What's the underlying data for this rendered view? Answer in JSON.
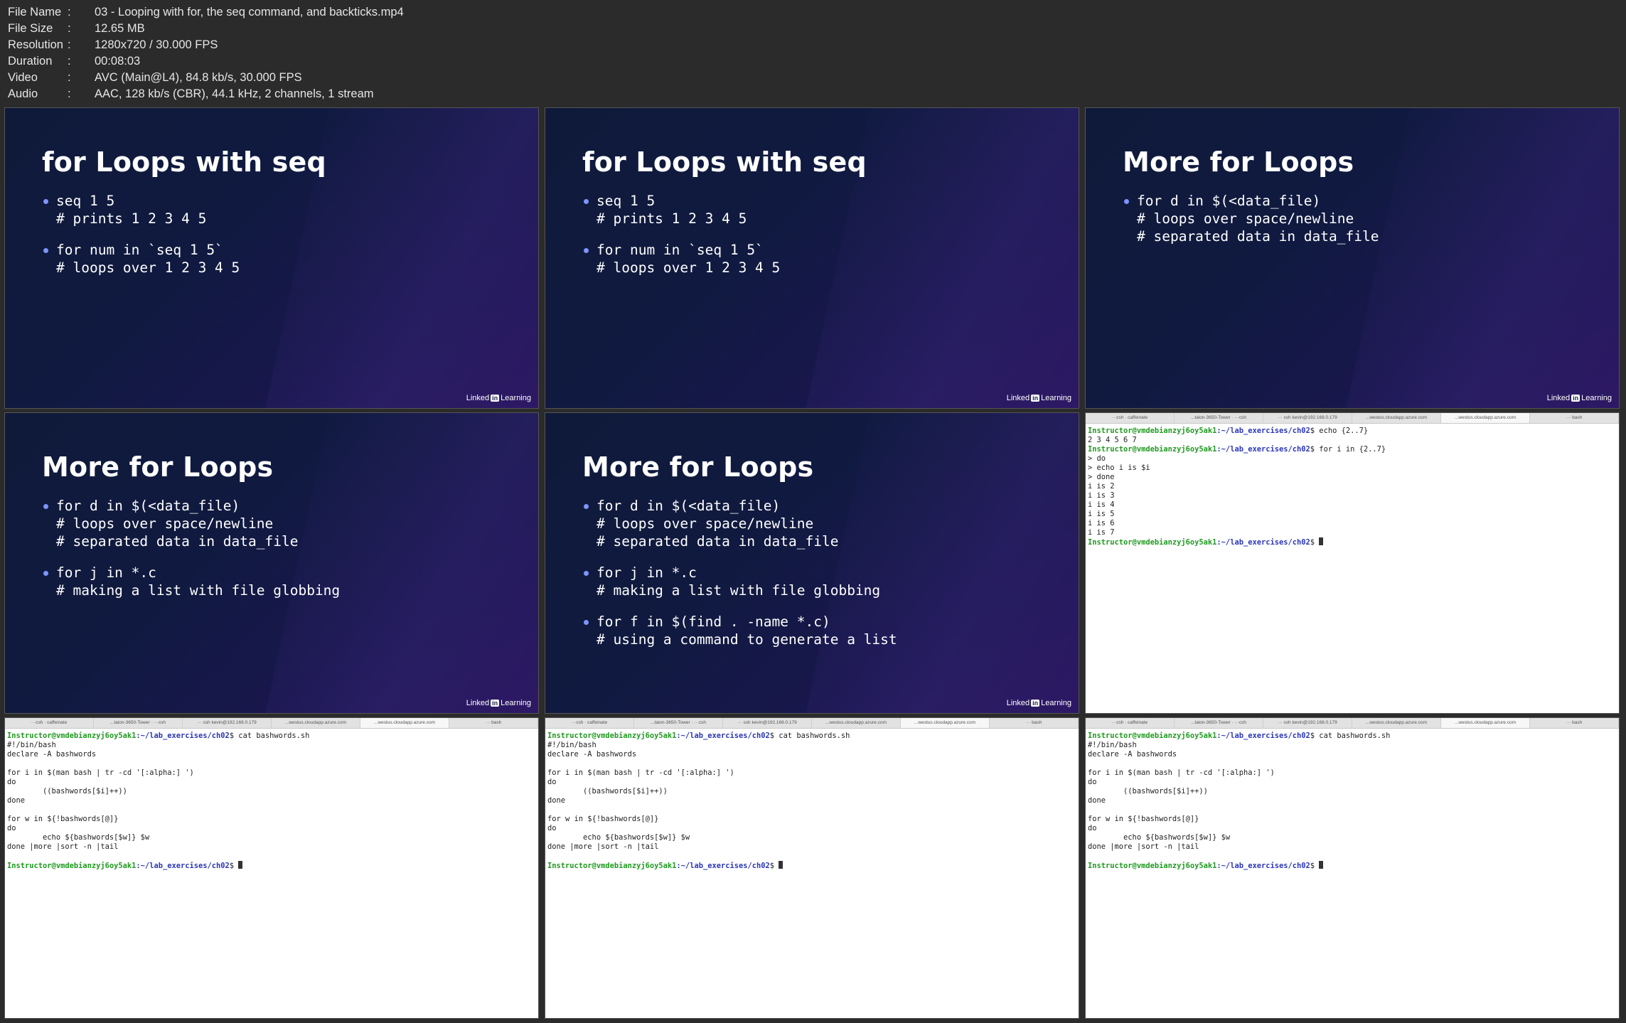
{
  "file_info": [
    {
      "key": "File Name",
      "value": "03 - Looping with for, the seq command, and backticks.mp4"
    },
    {
      "key": "File Size",
      "value": "12.65 MB"
    },
    {
      "key": "Resolution",
      "value": "1280x720 / 30.000 FPS"
    },
    {
      "key": "Duration",
      "value": "00:08:03"
    },
    {
      "key": "Video",
      "value": "AVC (Main@L4), 84.8 kb/s, 30.000 FPS"
    },
    {
      "key": "Audio",
      "value": "AAC, 128 kb/s (CBR), 44.1 kHz, 2 channels, 1 stream"
    }
  ],
  "separator": ":",
  "slide_logo": {
    "left": "Linked",
    "in": "in",
    "right": "Learning"
  },
  "terminal_tabs": [
    "···csh · caffeinate",
    "...taion-3650-Tower · ···csh",
    "··· ssh kevin@192.168.0.179",
    "...westus.cloudapp.azure.com",
    "...westus.cloudapp.azure.com",
    "··· bash"
  ],
  "frames": [
    {
      "title": "for Loops with seq",
      "bullets": [
        [
          "seq 1 5",
          "# prints 1 2 3 4 5"
        ],
        [
          "for num in `seq 1 5`",
          "# loops over 1 2 3 4 5"
        ]
      ]
    },
    {
      "title": "for Loops with seq",
      "bullets": [
        [
          "seq 1 5",
          "# prints 1 2 3 4 5"
        ],
        [
          "for num in `seq 1 5`",
          "# loops over 1 2 3 4 5"
        ]
      ]
    },
    {
      "title": "More for Loops",
      "bullets": [
        [
          "for d in $(<data_file)",
          "# loops over space/newline",
          "# separated data in data_file"
        ]
      ]
    },
    {
      "title": "More for Loops",
      "bullets": [
        [
          "for d in $(<data_file)",
          "# loops over space/newline",
          "# separated data in data_file"
        ],
        [
          "for j in *.c",
          "# making a list with file globbing"
        ]
      ]
    },
    {
      "title": "More for Loops",
      "bullets": [
        [
          "for d in $(<data_file)",
          "# loops over space/newline",
          "# separated data in data_file"
        ],
        [
          "for j in *.c",
          "# making a list with file globbing"
        ],
        [
          "for f in $(find . -name *.c)",
          "# using a command to generate a list"
        ]
      ]
    },
    {
      "active_tab": 4,
      "lines": [
        {
          "prompt": true,
          "user": "Instructor@vmdebianzyj6oy5ak1",
          "path": ":~/lab_exercises/ch02",
          "cmd": "$ echo {2..7}"
        },
        {
          "text": "2 3 4 5 6 7"
        },
        {
          "prompt": true,
          "user": "Instructor@vmdebianzyj6oy5ak1",
          "path": ":~/lab_exercises/ch02",
          "cmd": "$ for i in {2..7}"
        },
        {
          "text": "> do"
        },
        {
          "text": "> echo i is $i"
        },
        {
          "text": "> done"
        },
        {
          "text": "i is 2"
        },
        {
          "text": "i is 3"
        },
        {
          "text": "i is 4"
        },
        {
          "text": "i is 5"
        },
        {
          "text": "i is 6"
        },
        {
          "text": "i is 7"
        },
        {
          "prompt": true,
          "user": "Instructor@vmdebianzyj6oy5ak1",
          "path": ":~/lab_exercises/ch02",
          "cmd": "$ ",
          "cursor": true
        }
      ]
    },
    {
      "active_tab": 4,
      "lines": [
        {
          "prompt": true,
          "user": "Instructor@vmdebianzyj6oy5ak1",
          "path": ":~/lab_exercises/ch02",
          "cmd": "$ cat bashwords.sh"
        },
        {
          "text": "#!/bin/bash"
        },
        {
          "text": "declare -A bashwords"
        },
        {
          "text": ""
        },
        {
          "text": "for i in $(man bash | tr -cd '[:alpha:] ')"
        },
        {
          "text": "do"
        },
        {
          "text": "        ((bashwords[$i]++))"
        },
        {
          "text": "done"
        },
        {
          "text": ""
        },
        {
          "text": "for w in ${!bashwords[@]}"
        },
        {
          "text": "do"
        },
        {
          "text": "        echo ${bashwords[$w]} $w"
        },
        {
          "text": "done |more |sort -n |tail"
        },
        {
          "text": ""
        },
        {
          "prompt": true,
          "user": "Instructor@vmdebianzyj6oy5ak1",
          "path": ":~/lab_exercises/ch02",
          "cmd": "$ ",
          "cursor": true
        }
      ]
    },
    {
      "active_tab": 4,
      "lines": [
        {
          "prompt": true,
          "user": "Instructor@vmdebianzyj6oy5ak1",
          "path": ":~/lab_exercises/ch02",
          "cmd": "$ cat bashwords.sh"
        },
        {
          "text": "#!/bin/bash"
        },
        {
          "text": "declare -A bashwords"
        },
        {
          "text": ""
        },
        {
          "text": "for i in $(man bash | tr -cd '[:alpha:] ')"
        },
        {
          "text": "do"
        },
        {
          "text": "        ((bashwords[$i]++))"
        },
        {
          "text": "done"
        },
        {
          "text": ""
        },
        {
          "text": "for w in ${!bashwords[@]}"
        },
        {
          "text": "do"
        },
        {
          "text": "        echo ${bashwords[$w]} $w"
        },
        {
          "text": "done |more |sort -n |tail"
        },
        {
          "text": ""
        },
        {
          "prompt": true,
          "user": "Instructor@vmdebianzyj6oy5ak1",
          "path": ":~/lab_exercises/ch02",
          "cmd": "$ ",
          "cursor": true
        }
      ]
    },
    {
      "active_tab": 4,
      "lines": [
        {
          "prompt": true,
          "user": "Instructor@vmdebianzyj6oy5ak1",
          "path": ":~/lab_exercises/ch02",
          "cmd": "$ cat bashwords.sh"
        },
        {
          "text": "#!/bin/bash"
        },
        {
          "text": "declare -A bashwords"
        },
        {
          "text": ""
        },
        {
          "text": "for i in $(man bash | tr -cd '[:alpha:] ')"
        },
        {
          "text": "do"
        },
        {
          "text": "        ((bashwords[$i]++))"
        },
        {
          "text": "done"
        },
        {
          "text": ""
        },
        {
          "text": "for w in ${!bashwords[@]}"
        },
        {
          "text": "do"
        },
        {
          "text": "        echo ${bashwords[$w]} $w"
        },
        {
          "text": "done |more |sort -n |tail"
        },
        {
          "text": ""
        },
        {
          "prompt": true,
          "user": "Instructor@vmdebianzyj6oy5ak1",
          "path": ":~/lab_exercises/ch02",
          "cmd": "$ ",
          "cursor": true
        }
      ]
    }
  ]
}
